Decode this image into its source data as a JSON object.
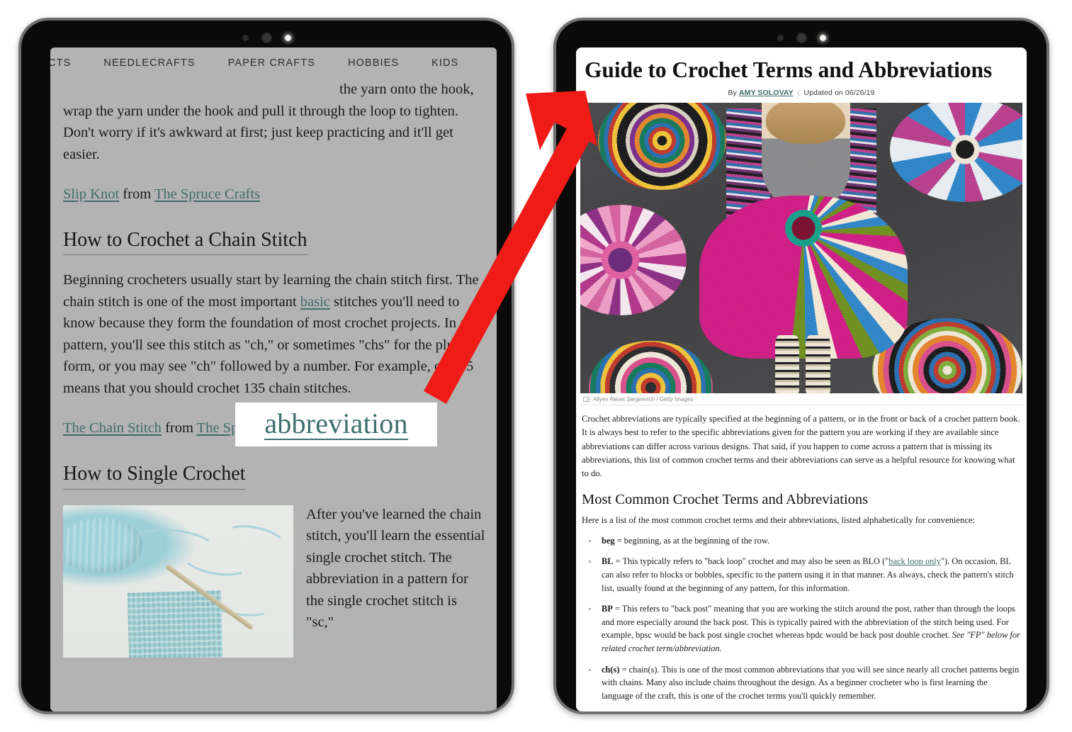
{
  "scene": {
    "description": "Two tablets side by side; red arrow points from highlighted word on left tablet to article title on right tablet",
    "accent_red": "#ee1b16",
    "link_teal": "#3f6b68",
    "left_screen_bg": "#b3b3b3",
    "right_screen_bg": "#ffffff"
  },
  "left_tablet": {
    "nav": {
      "items": [
        {
          "label": "JECTS"
        },
        {
          "label": "NEEDLECRAFTS"
        },
        {
          "label": "PAPER CRAFTS"
        },
        {
          "label": "HOBBIES"
        },
        {
          "label": "KIDS"
        }
      ]
    },
    "article": {
      "para_slipknot": "the yarn onto the hook, wrap the yarn under the hook and pull it through the loop to tighten. Don't worry if it's awkward at first; just keep practicing and it'll get easier.",
      "source_line_1": {
        "link_text": "Slip Knot",
        "middle": " from ",
        "source_text": "The Spruce Crafts"
      },
      "heading_chain": "How to Crochet a Chain Stitch",
      "para_chain_a": "Beginning crocheters usually start by learning the chain stitch first. The chain stitch is one of the most important ",
      "para_chain_link": "basic",
      "para_chain_b": " stitches you'll need to know because they form the foundation of most crochet projects. In a pattern, you'll see this stitch as \"ch,\" or sometimes \"chs\" for the plural form, or you may see \"ch\" followed by a number. For example, ch 135 means that you should crochet 135 chain stitches.",
      "source_line_2": {
        "link_text": "The Chain Stitch",
        "middle": " from ",
        "source_text": "The Spruce Crafts"
      },
      "heading_single": "How to Single Crochet",
      "para_single": "After you've learned the chain stitch, you'll learn the essential single crochet stitch. The abbreviation in a pattern for the single crochet stitch is \"sc,\"",
      "figure_alt": "light blue yarn ball, crochet hook and single crochet swatch"
    },
    "callout": {
      "word": "abbreviation"
    }
  },
  "right_tablet": {
    "article": {
      "title": "Guide to Crochet Terms and Abbreviations",
      "byline": {
        "prefix": "By ",
        "author": "AMY SOLOVAY",
        "updated": "Updated on 06/26/19"
      },
      "photo_caption": "Aliyev Alexei Sergeevich / Getty Images",
      "photo_alt": "Woman in colorful crochet clothing surrounded by crochet mandalas",
      "intro_paragraph": "Crochet abbreviations are typically specified at the beginning of a pattern, or in the front or back of a crochet pattern book. It is always best to refer to the specific abbreviations given for the pattern you are working if they are available since abbreviations can differ across various designs. That said, if you happen to come across a pattern that is missing its abbreviations, this list of common crochet terms and their abbreviations can serve as a helpful resource for knowing what to do.",
      "section_heading": "Most Common Crochet Terms and Abbreviations",
      "section_intro": "Here is a list of the most common crochet terms and their abbreviations, listed alphabetically for convenience:",
      "terms": [
        {
          "term": "beg",
          "body_a": " = beginning, as at the beginning of the row.",
          "link": "",
          "body_b": "",
          "italic": ""
        },
        {
          "term": "BL",
          "body_a": " = This typically refers to \"back loop\" crochet and may also be seen as BLO (\"",
          "link": "back loop only",
          "body_b": "\"). On occasion, BL can also refer to blocks or bobbles, specific to the pattern using it in that manner. As always, check the pattern's stitch list, usually found at the beginning of any pattern, for this information.",
          "italic": ""
        },
        {
          "term": "BP",
          "body_a": " = This refers to \"back post\" meaning that you are working the stitch around the post, rather than through the loops and more especially around the back post. This is typically paired with the abbreviation of the stitch being used. For example, bpsc would be back post single crochet whereas bpdc would be back post double crochet. ",
          "link": "",
          "body_b": "",
          "italic": "See \"FP\" below for related crochet term/abbreviation."
        },
        {
          "term": "ch(s)",
          "body_a": " = chain(s). This is one of the most common abbreviations that you will see since nearly all crochet patterns begin with chains. Many also include chains throughout the design. As a beginner crocheter who is first learning the language of the craft, this is one of the crochet terms you'll quickly remember.",
          "link": "",
          "body_b": "",
          "italic": ""
        }
      ]
    }
  }
}
